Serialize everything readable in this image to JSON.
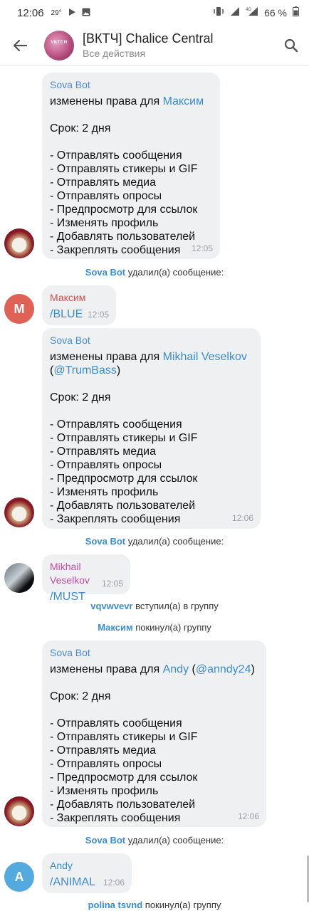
{
  "status": {
    "time": "12:06",
    "temp": "29°",
    "battery": "66 %",
    "network": "4G"
  },
  "header": {
    "title": "[ВКТЧ] Chalice Central",
    "subtitle": "Все действия",
    "avatar_text": "VKTCH"
  },
  "messages": [
    {
      "sender": "Sova Bot",
      "intro": "изменены права для ",
      "target": "Максим",
      "extra": "",
      "term": "Срок: 2 дня",
      "rights": [
        "- Отправлять сообщения",
        "- Отправлять стикеры и GIF",
        "- Отправлять медиа",
        "- Отправлять опросы",
        "- Предпросмотр для ссылок",
        "- Изменять профиль",
        "- Добавлять пользователей",
        "- Закреплять сообщения"
      ],
      "time": "12:05"
    },
    {
      "sender": "Sova Bot",
      "intro": "изменены права для ",
      "target": "Mikhail Veselkov",
      "extra_open": "(",
      "extra": "@TrumBass",
      "extra_close": ")",
      "term": "Срок: 2 дня",
      "rights": [
        "- Отправлять сообщения",
        "- Отправлять стикеры и GIF",
        "- Отправлять медиа",
        "- Отправлять опросы",
        "- Предпросмотр для ссылок",
        "- Изменять профиль",
        "- Добавлять пользователей",
        "- Закреплять сообщения"
      ],
      "time": "12:06"
    },
    {
      "sender": "Sova Bot",
      "intro": "изменены права для ",
      "target": "Andy",
      "extra_open": " (",
      "extra": "@anndy24",
      "extra_close": ")",
      "term": "Срок: 2 дня",
      "rights": [
        "- Отправлять сообщения",
        "- Отправлять стикеры и GIF",
        "- Отправлять медиа",
        "- Отправлять опросы",
        "- Предпросмотр для ссылок",
        "- Изменять профиль",
        "- Добавлять пользователей",
        "- Закреплять сообщения"
      ],
      "time": "12:06"
    }
  ],
  "short_messages": [
    {
      "sender": "Максим",
      "text": "/BLUE",
      "time": "12:05",
      "avatar_letter": "М"
    },
    {
      "sender": "Mikhail Veselkov",
      "text": "/MUST",
      "time": "12:05"
    },
    {
      "sender": "Andy",
      "text": "/ANIMAL",
      "time": "12:06",
      "avatar_letter": "A"
    }
  ],
  "service": [
    {
      "who": "Sova Bot",
      "action": " удалил(а) сообщение:"
    },
    {
      "who": "Sova Bot",
      "action": " удалил(а) сообщение:"
    },
    {
      "who": "vqvwvevr",
      "action": " вступил(а) в группу"
    },
    {
      "who": "Максим",
      "action": " покинул(а) группу"
    },
    {
      "who": "Sova Bot",
      "action": " удалил(а) сообщение:"
    },
    {
      "who": "polina tsvnd",
      "action": " покинул(а) группу"
    }
  ],
  "colors": {
    "bubble": "#eff0f1",
    "link": "#3b8cd0",
    "sova_name": "#4d8ad3",
    "maxim_name": "#d0504d",
    "mikhail_name": "#c24fa3"
  }
}
